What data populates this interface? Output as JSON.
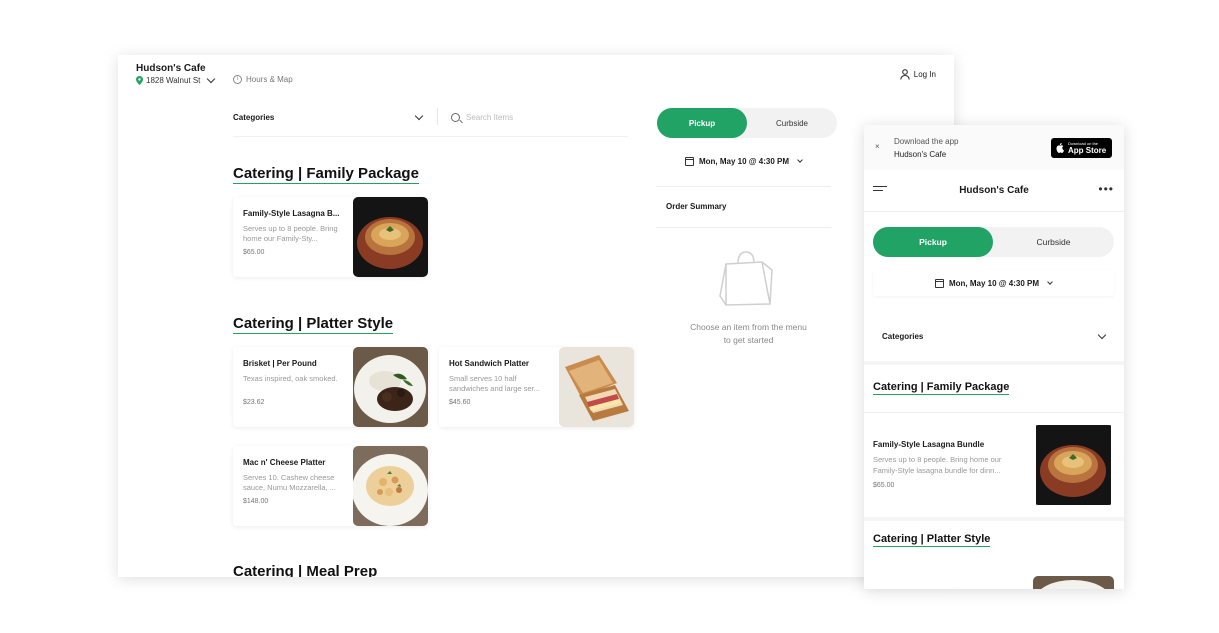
{
  "desktop": {
    "store_name": "Hudson's Cafe",
    "address": "1828 Walnut St",
    "hours_link": "Hours & Map",
    "login": "Log In",
    "categories_label": "Categories",
    "search_placeholder": "Search Items",
    "sections": [
      {
        "title": "Catering | Family Package",
        "items": [
          {
            "name": "Family-Style Lasagna B...",
            "desc": "Serves up to 8 people. Bring home our Family-Sty...",
            "price": "$65.00"
          }
        ]
      },
      {
        "title": "Catering | Platter Style",
        "items": [
          {
            "name": "Brisket | Per Pound",
            "desc": "Texas inspired, oak smoked.",
            "price": "$23.62"
          },
          {
            "name": "Hot Sandwich Platter",
            "desc": "Small serves 10 half sandwiches and large ser...",
            "price": "$45.60"
          },
          {
            "name": "Mac n' Cheese Platter",
            "desc": "Serves 10. Cashew cheese sauce, Numu Mozzarella, ...",
            "price": "$148.00"
          }
        ]
      },
      {
        "title": "Catering | Meal Prep"
      }
    ],
    "order": {
      "pickup": "Pickup",
      "curbside": "Curbside",
      "date": "Mon, May 10 @ 4:30 PM",
      "summary_title": "Order Summary",
      "empty_line1": "Choose an item from the menu",
      "empty_line2": "to get started"
    }
  },
  "mobile": {
    "banner_close": "×",
    "banner_text": "Download the app",
    "banner_store": "Hudson's Cafe",
    "appstore_small": "Download on the",
    "appstore_big": "App Store",
    "title": "Hudson's Cafe",
    "pickup": "Pickup",
    "curbside": "Curbside",
    "date": "Mon, May 10 @ 4:30 PM",
    "categories_label": "Categories",
    "section1": "Catering | Family Package",
    "item": {
      "name": "Family-Style Lasagna Bundle",
      "desc": "Serves up to 8 people. Bring home our Family-Style lasagna bundle for dinn...",
      "price": "$65.00"
    },
    "section2": "Catering | Platter Style"
  },
  "colors": {
    "accent": "#21a366",
    "text": "#1a1a1a",
    "muted": "#999999"
  },
  "icons": [
    "location-pin-icon",
    "info-icon",
    "user-icon",
    "search-icon",
    "chevron-down-icon",
    "calendar-icon",
    "shopping-bag-icon",
    "menu-icon",
    "more-icon",
    "close-icon",
    "apple-icon"
  ]
}
